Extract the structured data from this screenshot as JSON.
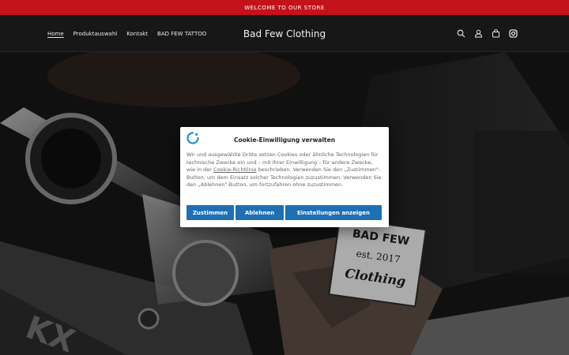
{
  "announcement": {
    "text": "WELCOME TO OUR STORE"
  },
  "nav": {
    "items": [
      "Home",
      "Produktauswahl",
      "Kontakt",
      "BAD FEW TATTOO"
    ]
  },
  "brand": {
    "name": "Bad Few Clothing"
  },
  "header_icons": [
    "search-icon",
    "account-icon",
    "cart-icon",
    "instagram-icon"
  ],
  "hero": {
    "label_lines": [
      "BAD FEW",
      "est. 2017",
      "Clothing"
    ]
  },
  "cookie": {
    "title": "Cookie-Einwilligung verwalten",
    "body_before_link": "Wir und ausgewählte Dritte setzen Cookies oder ähnliche Technologien für technische Zwecke ein und – mit Ihrer Einwilligung – für andere Zwecke, wie in der ",
    "link_text": "Cookie-Richtlinie",
    "body_after_link": " beschrieben. Verwenden Sie den „Zustimmen\"-Button, um dem Einsatz solcher Technologien zuzustimmen. Verwenden Sie den „Ablehnen\"-Button, um fortzufahren ohne zuzustimmen.",
    "accept_label": "Zustimmen",
    "deny_label": "Ablehnen",
    "settings_label": "Einstellungen anzeigen"
  },
  "colors": {
    "announcement_bg": "#c4121a",
    "header_bg": "#171717",
    "button_blue": "#1e6fb4"
  }
}
